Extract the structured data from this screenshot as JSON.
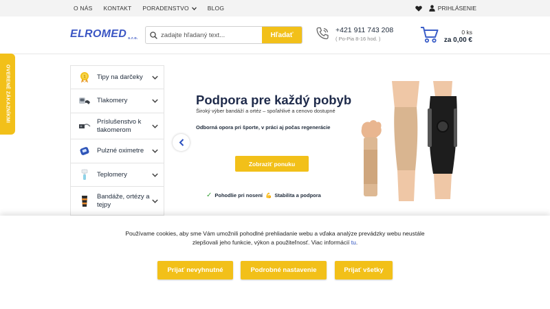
{
  "topnav": {
    "items": [
      "O NÁS",
      "KONTAKT",
      "PORADENSTVO",
      "BLOG"
    ],
    "login": "PRIHLÁSENIE"
  },
  "header": {
    "logo": "ELROMED",
    "logo_suffix": "s.r.o.",
    "search_placeholder": "zadajte hľadaný text...",
    "search_button": "Hľadať",
    "phone": "+421 911 743 208",
    "phone_hours": "( Po-Pia 8-16 hod. )",
    "cart_count": "0 ks",
    "cart_total": "za 0,00 €"
  },
  "badge": "OVERENÉ ZÁKAZNÍKMI",
  "categories": [
    {
      "label": "Tipy na darčeky",
      "icon": "gift-badge-icon"
    },
    {
      "label": "Tlakomery",
      "icon": "blood-pressure-monitor-icon"
    },
    {
      "label": "Príslušenstvo k tlakomerom",
      "icon": "cuff-accessory-icon"
    },
    {
      "label": "Pulzné oximetre",
      "icon": "pulse-oximeter-icon"
    },
    {
      "label": "Teplomery",
      "icon": "thermometer-icon"
    },
    {
      "label": "Bandáže, ortézy a tejpy",
      "icon": "bandage-icon"
    }
  ],
  "hero": {
    "title": "Podpora pre každý pobyb",
    "subtitle": "Široký výber bandáží a ortéz – spoľahlivé a cenovo dostupné",
    "subtitle2": "Odborná opora pri športe, v práci aj počas regenerácie",
    "button": "Zobraziť ponuku",
    "feature1": "Pohodlie pri nosení",
    "feature2": "Stabilita a podpora"
  },
  "cookie": {
    "text": "Používame cookies, aby sme Vám umožnili pohodlné prehliadanie webu a vďaka analýze prevádzky webu neustále zlepšovali jeho funkcie, výkon a použiteľnosť. Viac informácií",
    "link": "tu",
    "end": ".",
    "btn_necessary": "Prijať nevyhnutné",
    "btn_settings": "Podrobné nastavenie",
    "btn_all": "Prijať všetky"
  },
  "colors": {
    "accent": "#f2c019",
    "brand": "#3b56c4",
    "text": "#1e2a3a"
  }
}
